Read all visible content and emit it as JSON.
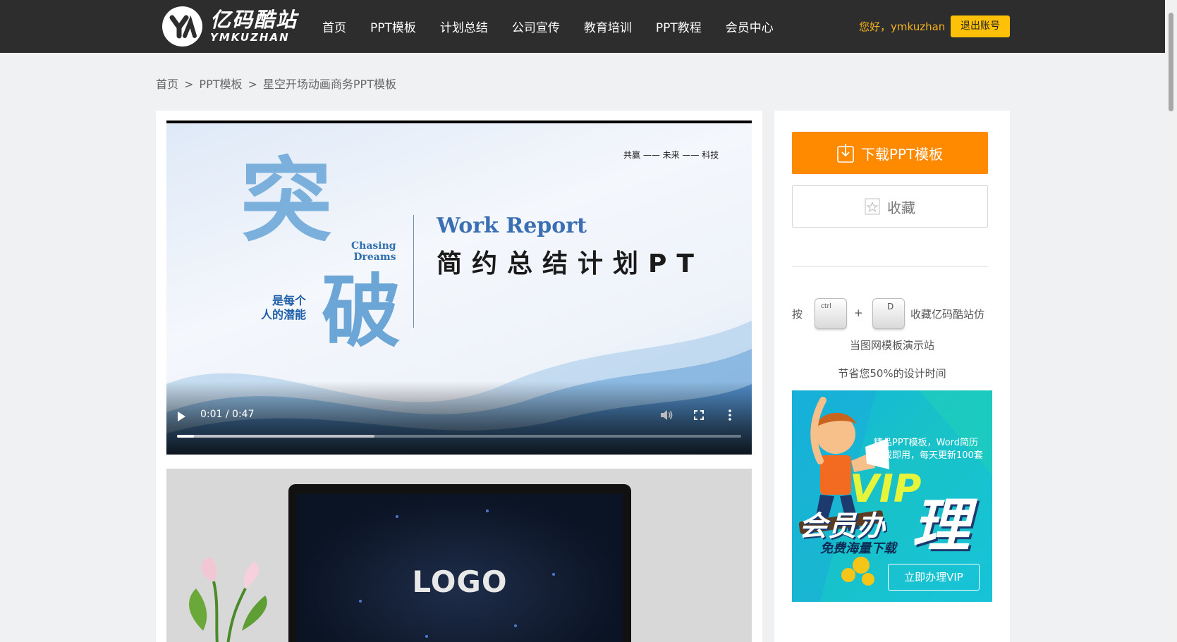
{
  "header": {
    "logo_cn": "亿码酷站",
    "logo_en": "YMKUZHAN",
    "nav": [
      "首页",
      "PPT模板",
      "计划总结",
      "公司宣传",
      "教育培训",
      "PPT教程",
      "会员中心"
    ],
    "greeting": "您好，ymkuzhan",
    "logout_label": "退出账号"
  },
  "breadcrumb": [
    "首页",
    "PPT模板",
    "星空开场动画商务PPT模板"
  ],
  "breadcrumb_sep": ">",
  "video": {
    "slide_tag": "共赢 —— 未来 —— 科技",
    "big_char1": "突",
    "big_char2": "破",
    "chasing_line1": "Chasing",
    "chasing_line2": "Dreams",
    "potential_line1": "是每个",
    "potential_line2": "人的潜能",
    "work_report": "Work Report",
    "title_cn": "简约总结计划PT",
    "time": "0:01 / 0:47",
    "played_fraction": 0.03,
    "buffered_fraction": 0.35
  },
  "preview2": {
    "logo_text": "LOGO"
  },
  "sidebar": {
    "download_label": "下载PPT模板",
    "favorite_label": "收藏",
    "tip_press": "按",
    "key_ctrl": "ctrl",
    "key_plus": "+",
    "key_d": "D",
    "tip_line1": "收藏亿码酷站仿",
    "tip_line2": "当图网模板演示站",
    "tip_line3": "节省您50%的设计时间",
    "vip": {
      "desc_line1": "精品PPT模板，Word简历",
      "desc_line2": "下载即用，每天更新100套",
      "big": "VIP",
      "big2": "会员办",
      "li": "理",
      "sub": "免费海量下载",
      "button": "立即办理VIP"
    }
  },
  "colors": {
    "header_bg": "#2d2d2d",
    "accent_orange": "#ff8a00",
    "logout_yellow": "#ffc107",
    "greeting": "#f5b220",
    "vip_bg": "#16c3d8"
  }
}
